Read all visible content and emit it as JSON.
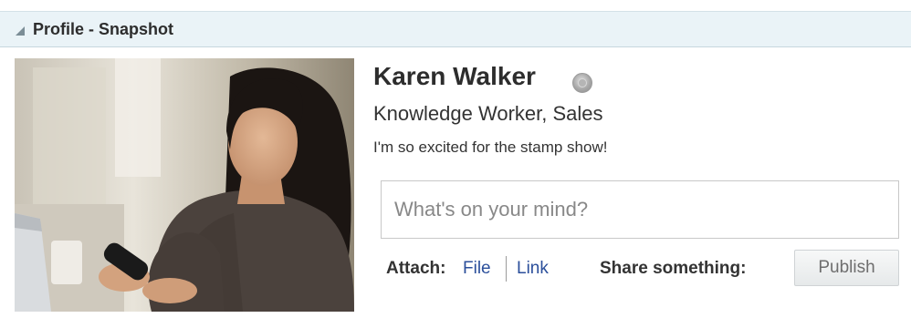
{
  "panel": {
    "title": "Profile - Snapshot",
    "disclosure_icon": "triangle-expanded-icon"
  },
  "profile": {
    "name": "Karen Walker",
    "presence_icon": "presence-status-icon",
    "presence_color": "#a8a8a8",
    "job_title": "Knowledge Worker, Sales",
    "status_message": "I'm so excited for the stamp show!"
  },
  "composer": {
    "placeholder": "What's on your mind?",
    "value": "",
    "attach_label": "Attach:",
    "attach_file": "File",
    "attach_link": "Link",
    "share_label": "Share something:",
    "publish_label": "Publish"
  },
  "colors": {
    "header_bg": "#eaf3f7",
    "link": "#2b4f9b"
  }
}
